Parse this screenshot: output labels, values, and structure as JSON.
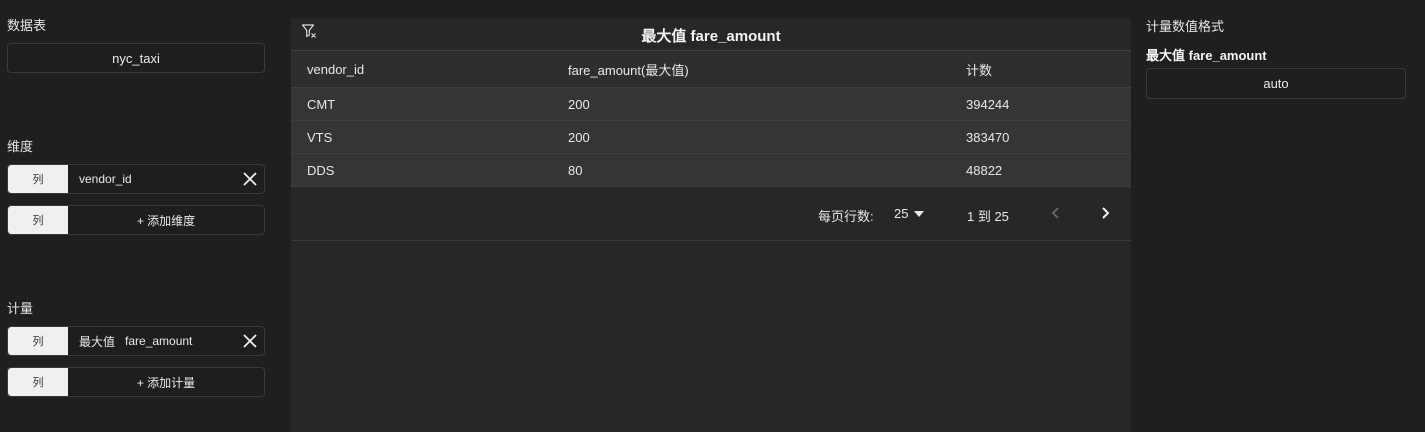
{
  "left": {
    "table_label": "数据表",
    "table_value": "nyc_taxi",
    "dimensions_label": "维度",
    "dimension_tag": "列",
    "dimension_value": "vendor_id",
    "add_dimension_tag": "列",
    "add_dimension_label": "+ 添加维度",
    "measures_label": "计量",
    "measure_tag": "列",
    "measure_agg": "最大值",
    "measure_field": "fare_amount",
    "add_measure_tag": "列",
    "add_measure_label": "+ 添加计量"
  },
  "center": {
    "title": "最大值 fare_amount",
    "columns": [
      "vendor_id",
      "fare_amount(最大值)",
      "计数"
    ],
    "rows": [
      [
        "CMT",
        "200",
        "394244"
      ],
      [
        "VTS",
        "200",
        "383470"
      ],
      [
        "DDS",
        "80",
        "48822"
      ]
    ],
    "pager": {
      "rows_per_page_label": "每页行数:",
      "rows_per_page_value": "25",
      "range": "1 到 25"
    }
  },
  "right": {
    "title": "计量数值格式",
    "measure_name": "最大值 fare_amount",
    "format_value": "auto"
  },
  "icons": {
    "close": "close-icon",
    "filter": "filter-clear-icon",
    "dropdown": "caret-down-icon",
    "prev": "chevron-left-icon",
    "next": "chevron-right-icon"
  }
}
